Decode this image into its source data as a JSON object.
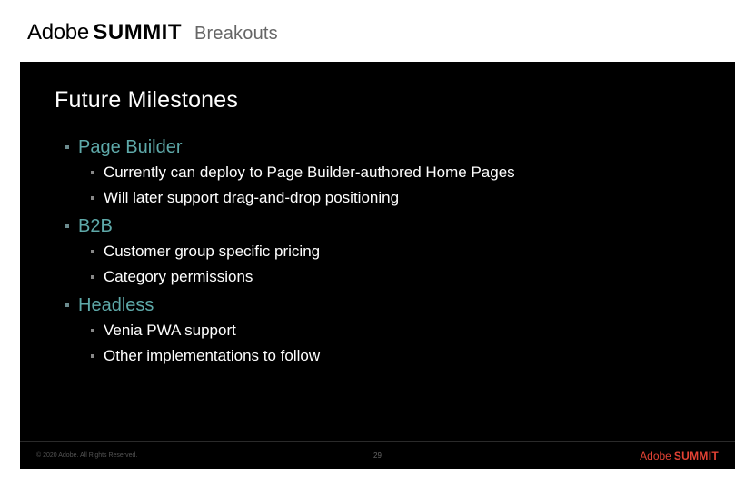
{
  "header": {
    "adobe": "Adobe",
    "summit": "SUMMIT",
    "breakouts": "Breakouts"
  },
  "slide": {
    "title": "Future Milestones",
    "topics": [
      {
        "label": "Page Builder",
        "items": [
          "Currently can deploy to Page Builder-authored Home Pages",
          "Will later support drag-and-drop positioning"
        ]
      },
      {
        "label": "B2B",
        "items": [
          "Customer group specific pricing",
          "Category permissions"
        ]
      },
      {
        "label": "Headless",
        "items": [
          "Venia PWA support",
          "Other implementations to follow"
        ]
      }
    ]
  },
  "footer": {
    "copyright": "© 2020 Adobe. All Rights Reserved.",
    "page": "29",
    "adobe": "Adobe",
    "summit": "SUMMIT"
  }
}
